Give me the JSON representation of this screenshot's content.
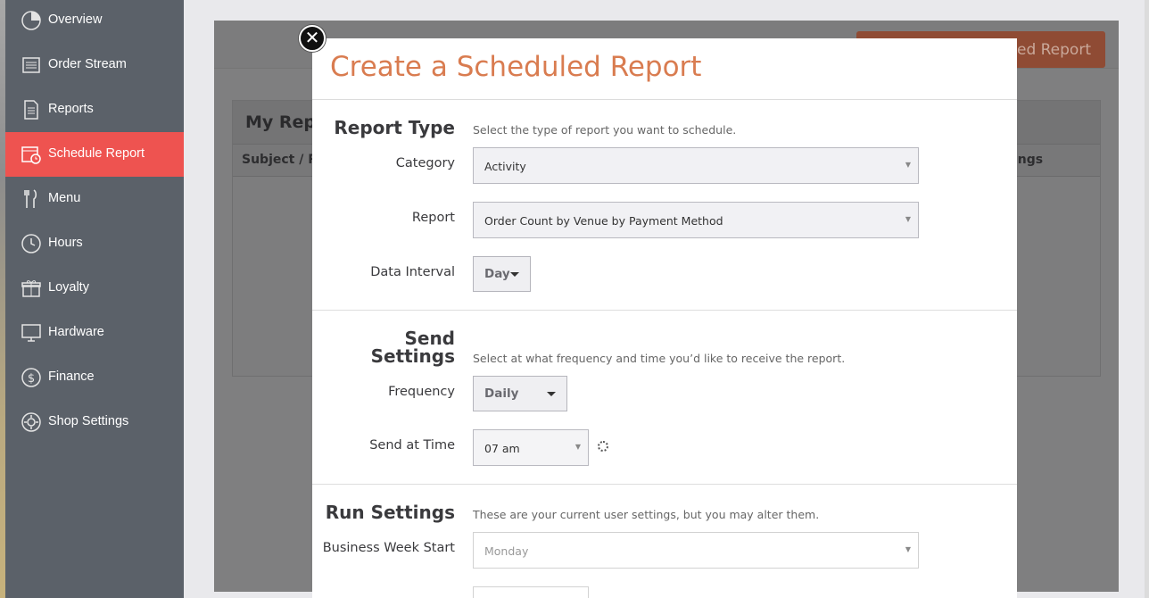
{
  "sidebar": {
    "items": [
      {
        "label": "Overview",
        "icon": "pie-chart-icon",
        "active": false
      },
      {
        "label": "Order Stream",
        "icon": "order-stream-icon",
        "active": false
      },
      {
        "label": "Reports",
        "icon": "document-icon",
        "active": false
      },
      {
        "label": "Schedule Report",
        "icon": "calendar-clock-icon",
        "active": true
      },
      {
        "label": "Menu",
        "icon": "fork-knife-icon",
        "active": false
      },
      {
        "label": "Hours",
        "icon": "clock-icon",
        "active": false
      },
      {
        "label": "Loyalty",
        "icon": "gift-icon",
        "active": false
      },
      {
        "label": "Hardware",
        "icon": "monitor-icon",
        "active": false
      },
      {
        "label": "Finance",
        "icon": "dollar-circle-icon",
        "active": false
      },
      {
        "label": "Shop Settings",
        "icon": "gear-icon",
        "active": false
      }
    ]
  },
  "background": {
    "new_button_label": "ed Report",
    "panel_title": "My Repo",
    "col_subject": "Subject / Re",
    "col_settings": "ings"
  },
  "modal": {
    "title": "Create a Scheduled Report",
    "close_glyph": "✕",
    "report_type": {
      "title": "Report Type",
      "description": "Select the type of report you want to schedule.",
      "category_label": "Category",
      "category_value": "Activity",
      "report_label": "Report",
      "report_value": "Order Count by Venue by Payment Method",
      "interval_label": "Data Interval",
      "interval_value": "Day"
    },
    "send_settings": {
      "title_line1": "Send",
      "title_line2": "Settings",
      "description": "Select at what frequency and time you’d like to receive the report.",
      "frequency_label": "Frequency",
      "frequency_value": "Daily",
      "time_label": "Send at Time",
      "time_value": "07 am"
    },
    "run_settings": {
      "title": "Run Settings",
      "description": "These are your current user settings, but you may alter them.",
      "week_start_label": "Business Week Start",
      "week_start_value": "Monday"
    }
  },
  "colors": {
    "accent": "#ee5350",
    "title": "#d97c50",
    "sidebar": "#5b6169"
  }
}
